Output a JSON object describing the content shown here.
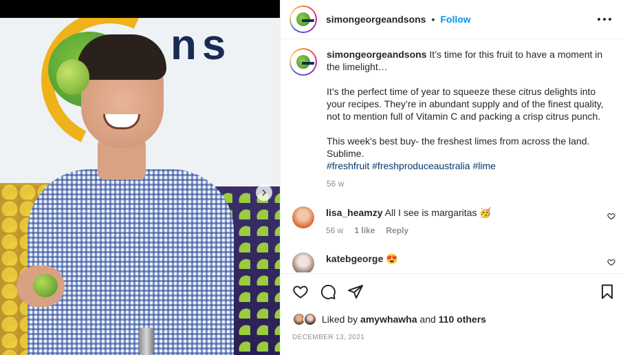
{
  "post": {
    "username": "simongeorgeandsons",
    "separator": "•",
    "follow_label": "Follow"
  },
  "media": {
    "wall_text": "ns",
    "next_icon": "chevron-right-icon"
  },
  "caption": {
    "username": "simongeorgeandsons",
    "line1": "It’s time for this fruit to have a moment in the limelight…",
    "line2": "It’s the perfect time of year to squeeze these citrus delights into your recipes. They’re in abundant supply and of the finest quality, not to mention full of Vitamin C and packing a crisp citrus punch.",
    "line3": "This week's best buy- the freshest limes from across the land. Sublime.",
    "hashtags": [
      "#freshfruit",
      "#freshproduceaustralia",
      "#lime"
    ],
    "time": "56 w"
  },
  "comments": [
    {
      "username": "lisa_heamzy",
      "text": "All I see is margaritas 🥳",
      "time": "56 w",
      "likes": "1 like",
      "reply": "Reply"
    },
    {
      "username": "katebgeorge",
      "text": "😍"
    }
  ],
  "actions": {
    "like_icon": "heart-icon",
    "comment_icon": "comment-icon",
    "share_icon": "paper-plane-icon",
    "save_icon": "bookmark-icon"
  },
  "likes": {
    "prefix": "Liked by",
    "user": "amywhawha",
    "and": "and",
    "others": "110 others"
  },
  "date": "DECEMBER 13, 2021"
}
